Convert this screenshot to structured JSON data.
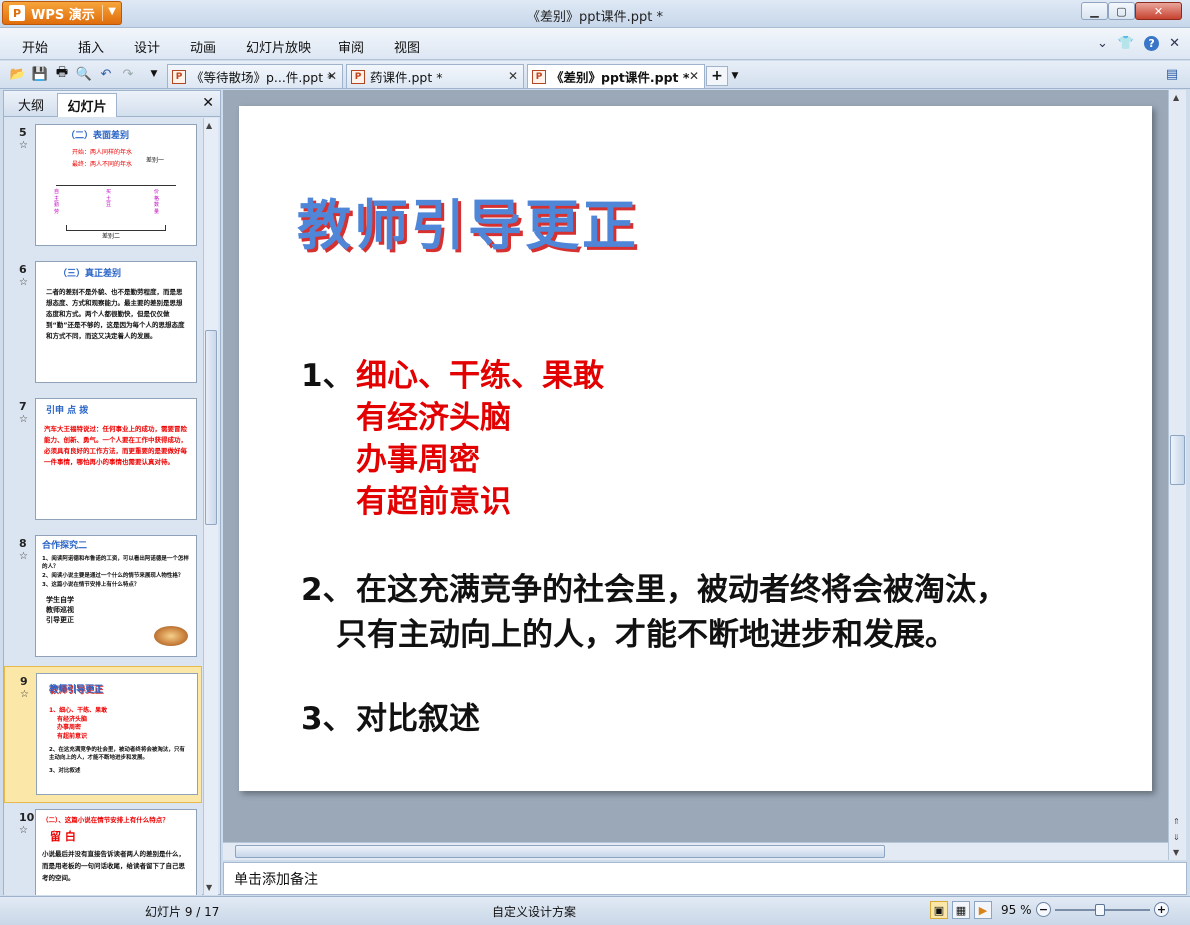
{
  "app": {
    "button_label": "WPS 演示",
    "logo_glyph": "P"
  },
  "window": {
    "title": "《差别》ppt课件.ppt *"
  },
  "menu": [
    "开始",
    "插入",
    "设计",
    "动画",
    "幻灯片放映",
    "审阅",
    "视图"
  ],
  "doc_tabs": [
    {
      "label": "《等待散场》p...件.ppt *"
    },
    {
      "label": "药课件.ppt *"
    },
    {
      "label": "《差别》ppt课件.ppt *"
    }
  ],
  "panel": {
    "tab_outline": "大纲",
    "tab_slides": "幻灯片"
  },
  "thumbnails": [
    {
      "num": "5",
      "title": "（二）表面差别",
      "lines": [
        "开始：两人同样的年水",
        "最终：两人不同的年水",
        "差别一",
        "差别二"
      ]
    },
    {
      "num": "6",
      "title": "（三）真正差别",
      "lines": [
        "二者的差别不是外貌、也不是勤劳程度，而是思想态度、方式和观察能力。最主要的差别是思想态度和方式。两个人都很勤快，但是仅仅做到“勤”还是不够的，这是因为每个人的思想态度和方式不同，而这又决定着人的发展。"
      ]
    },
    {
      "num": "7",
      "title": "引申 点 拨",
      "lines": [
        "汽车大王福特说过：任何事业上的成功，需要冒险能力、创新、勇气。一个人要在工作中获得成功，必须具有良好的工作方法，而更重要的是要做好每一件事情，哪怕再小的事情也需要认真对待。"
      ]
    },
    {
      "num": "8",
      "title": "合作探究二",
      "lines": [
        "1、阅读阿诺德和布鲁诺的工资，可以看出阿诺德是一个怎样的人？",
        "2、阅读小说主要是通过一个什么的情节来展现人物性格？",
        "3、这篇小说在情节安排上有什么特点？",
        "学生自学",
        "教师巡视",
        "引导更正"
      ]
    },
    {
      "num": "9",
      "title": "教师引导更正",
      "lines": [
        "1、细心、干练、果敢",
        "有经济头脑",
        "办事周密",
        "有超前意识",
        "2、在这充满竞争的社会里，被动者终将会被淘汰，只有主动向上的人，才能不断地进步和发展。",
        "3、对比叙述"
      ]
    },
    {
      "num": "10",
      "title": "（二）、这篇小说在情节安排上有什么特点？",
      "lines": [
        "留 白",
        "小说最后并没有直接告诉读者两人的差别是什么，而是用老板的一句问话收尾，给读者留下了自己思考的空间。"
      ]
    }
  ],
  "slide": {
    "title": "教师引导更正",
    "items": [
      {
        "prefix": "1、",
        "lines": [
          "细心、干练、果敢",
          "有经济头脑",
          "办事周密",
          "有超前意识"
        ]
      },
      {
        "prefix": "2、",
        "lines": [
          "在这充满竞争的社会里，被动者终将会被淘汰，",
          "只有主动向上的人，才能不断地进步和发展。"
        ]
      },
      {
        "prefix": "3、",
        "lines": [
          "对比叙述"
        ]
      }
    ]
  },
  "notes": {
    "placeholder": "单击添加备注"
  },
  "status": {
    "slide_count": "幻灯片 9 / 17",
    "design": "自定义设计方案",
    "zoom": "95 %"
  },
  "colors": {
    "title_blue": "#4f86d8",
    "title_shadow": "#d63030",
    "red_text": "#e20000",
    "accent_orange": "#e06d0b"
  }
}
